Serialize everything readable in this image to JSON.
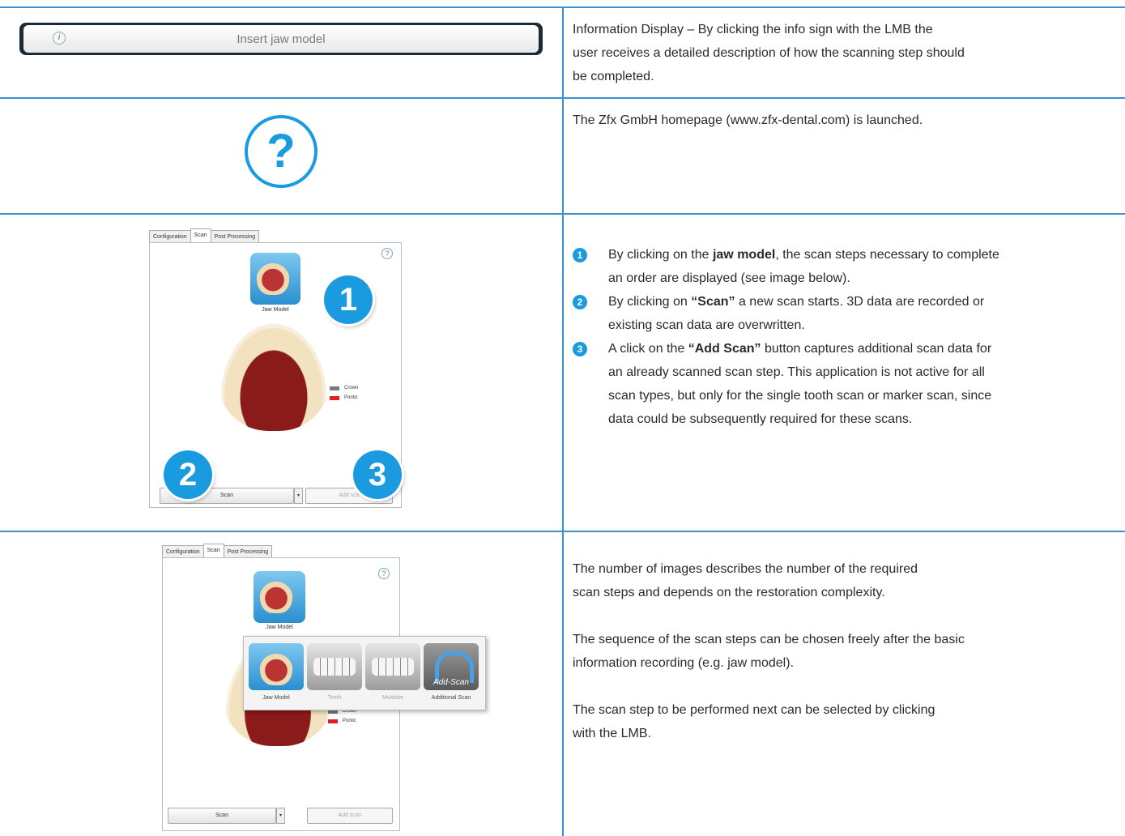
{
  "info_bar": {
    "label": "Insert jaw model",
    "icon": "info-icon"
  },
  "row1": {
    "line1": "Information Display – By clicking the info sign with the LMB the",
    "line2": "user receives a detailed description of how the scanning step should",
    "line3": "be completed."
  },
  "row2": {
    "help_symbol": "?",
    "text": "The Zfx GmbH homepage (www.zfx-dental.com) is launched."
  },
  "screenshot": {
    "tabs": [
      "Configuration",
      "Scan",
      "Post Processing"
    ],
    "help_symbol": "?",
    "jaw_model_label": "Jaw Model",
    "legend": [
      {
        "label": "Crown",
        "color": "#7a7a7a"
      },
      {
        "label": "Pontic",
        "color": "#e02020"
      }
    ],
    "scan_button": "Scan",
    "dropdown_arrow": "▾",
    "add_scan_button_partial": "Add sca",
    "add_scan_button": "Add scan",
    "callouts": [
      "1",
      "2",
      "3"
    ]
  },
  "row3": {
    "items": [
      {
        "num": "1",
        "pre": "By clicking on the ",
        "bold": "jaw model",
        "post": ", the scan steps necessary to complete",
        "line2": "an order are displayed (see image below)."
      },
      {
        "num": "2",
        "pre": "By clicking on ",
        "bold": "“Scan”",
        "post": " a new scan starts. 3D data are recorded or",
        "line2": "existing scan data are overwritten."
      },
      {
        "num": "3",
        "pre": "A click on the ",
        "bold": "“Add Scan”",
        "post": " button captures additional scan data for",
        "line2": "an already scanned scan step. This application is not active for all",
        "line3": "scan types, but only for the single tooth scan or marker scan, since",
        "line4": "data could be subsequently required for these scans."
      }
    ]
  },
  "popup": {
    "items": [
      "Jaw Model",
      "Teeth",
      "Multibite",
      "Additional Scan"
    ],
    "add_scan_overlay": "Add-Scan"
  },
  "row4": {
    "p1_line1": "The number of images describes the number of the required",
    "p1_line2": "scan steps and depends on the restoration complexity.",
    "p2_line1": "The sequence of the scan steps can be chosen freely after the basic",
    "p2_line2": "information recording (e.g. jaw model).",
    "p3_line1": "The scan step to be performed next can be selected by clicking",
    "p3_line2": "with the LMB."
  }
}
